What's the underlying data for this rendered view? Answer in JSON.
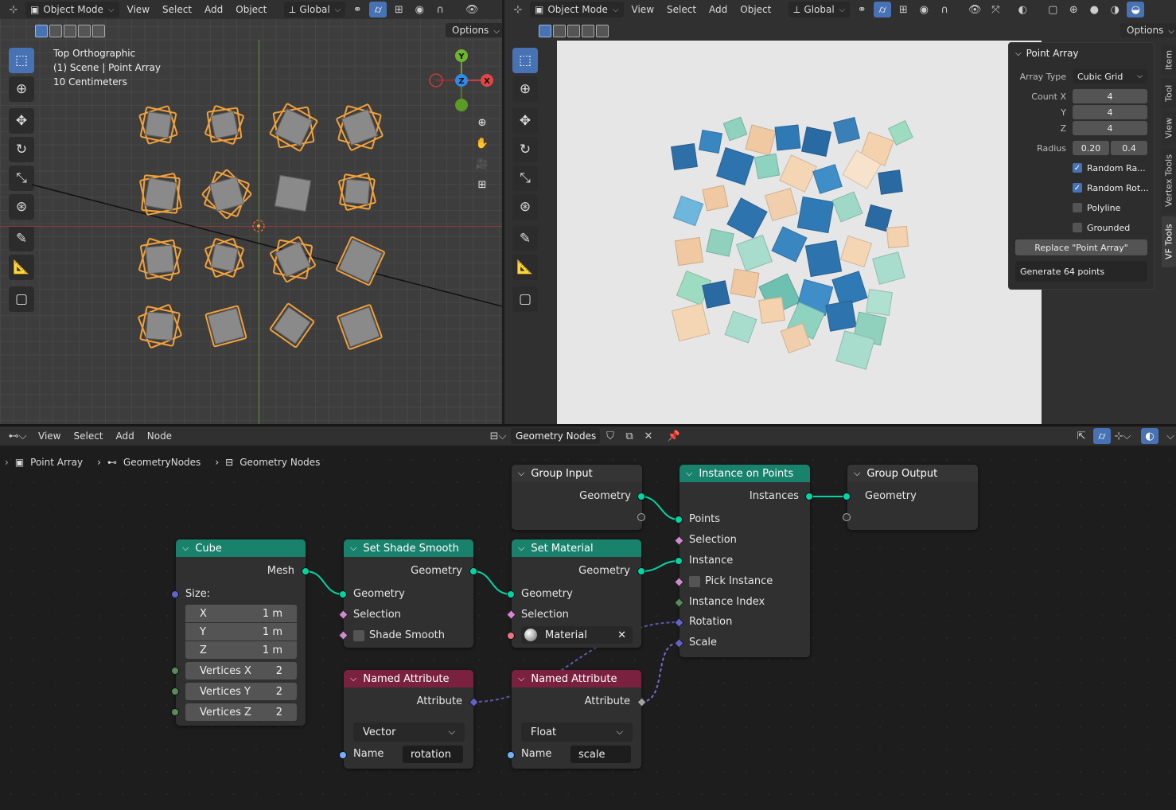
{
  "left_viewport": {
    "mode": "Object Mode",
    "menus": [
      "View",
      "Select",
      "Add",
      "Object"
    ],
    "transform": "Global",
    "options_label": "Options",
    "info": [
      "Top Orthographic",
      "(1) Scene | Point Array",
      "10 Centimeters"
    ],
    "gizmo": {
      "y": "Y",
      "z": "Z",
      "x": "X"
    }
  },
  "right_viewport": {
    "mode": "Object Mode",
    "menus": [
      "View",
      "Select",
      "Add",
      "Object"
    ],
    "transform": "Global",
    "options_label": "Options",
    "side_tabs": [
      "Item",
      "Tool",
      "View",
      "Vertex Tools",
      "VF Tools"
    ]
  },
  "point_array": {
    "title": "Point Array",
    "array_type_label": "Array Type",
    "array_type_value": "Cubic Grid",
    "count_x_label": "Count X",
    "count_x": "4",
    "y_label": "Y",
    "count_y": "4",
    "z_label": "Z",
    "count_z": "4",
    "radius_label": "Radius",
    "radius_min": "0.20",
    "radius_max": "0.4",
    "random_radius": "Random Ra...",
    "random_rotation": "Random Rot...",
    "polyline": "Polyline",
    "grounded": "Grounded",
    "replace_button": "Replace \"Point Array\"",
    "generate_label": "Generate 64 points"
  },
  "node_editor": {
    "menus": [
      "View",
      "Select",
      "Add",
      "Node"
    ],
    "tree_name": "Geometry Nodes",
    "breadcrumb": [
      "Point Array",
      "GeometryNodes",
      "Geometry Nodes"
    ]
  },
  "nodes": {
    "group_input": {
      "title": "Group Input",
      "out_geometry": "Geometry"
    },
    "instance_on_points": {
      "title": "Instance on Points",
      "out_instances": "Instances",
      "points": "Points",
      "selection": "Selection",
      "instance": "Instance",
      "pick_instance": "Pick Instance",
      "instance_index": "Instance Index",
      "rotation": "Rotation",
      "scale": "Scale"
    },
    "group_output": {
      "title": "Group Output",
      "geometry": "Geometry"
    },
    "cube": {
      "title": "Cube",
      "out_mesh": "Mesh",
      "size": "Size:",
      "x_label": "X",
      "x": "1 m",
      "y_label": "Y",
      "y": "1 m",
      "z_label": "Z",
      "z": "1 m",
      "vx_label": "Vertices X",
      "vx": "2",
      "vy_label": "Vertices Y",
      "vy": "2",
      "vz_label": "Vertices Z",
      "vz": "2"
    },
    "set_shade_smooth": {
      "title": "Set Shade Smooth",
      "out_geometry": "Geometry",
      "geometry": "Geometry",
      "selection": "Selection",
      "shade_smooth": "Shade Smooth"
    },
    "set_material": {
      "title": "Set Material",
      "out_geometry": "Geometry",
      "geometry": "Geometry",
      "selection": "Selection",
      "material": "Material"
    },
    "named_attr_1": {
      "title": "Named Attribute",
      "out_attr": "Attribute",
      "type": "Vector",
      "name_label": "Name",
      "name": "rotation"
    },
    "named_attr_2": {
      "title": "Named Attribute",
      "out_attr": "Attribute",
      "type": "Float",
      "name_label": "Name",
      "name": "scale"
    }
  },
  "colors": {
    "accent": "#4772b3",
    "geometry_socket": "#00d6a3",
    "selection_orange": "#f3a13a"
  }
}
